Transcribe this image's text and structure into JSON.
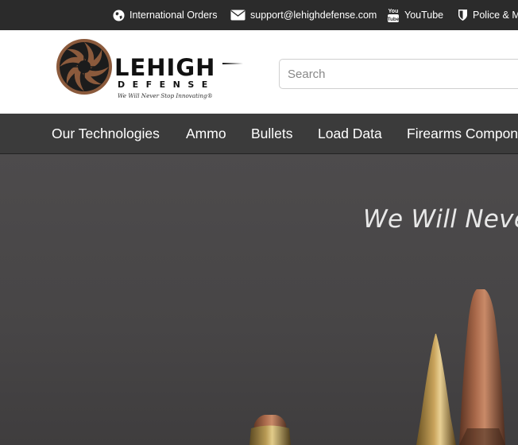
{
  "topbar": {
    "international_orders": "International Orders",
    "email": "support@lehighdefense.com",
    "youtube": "YouTube",
    "police_military": "Police & Mi"
  },
  "header": {
    "logo_wordmark": "LEHIGH",
    "logo_sub": "DEFENSE",
    "logo_tagline": "We Will Never Stop Innovating®",
    "search_placeholder": "Search"
  },
  "nav": {
    "items": [
      "Our Technologies",
      "Ammo",
      "Bullets",
      "Load Data",
      "Firearms Compon"
    ]
  },
  "hero": {
    "headline": "We Will Never"
  },
  "colors": {
    "topbar_bg": "#2b2b2b",
    "nav_bg": "#3b3b3b",
    "hero_bg": "#4a4849",
    "brand_copper": "#8b5a3c"
  },
  "icons": [
    "globe-icon",
    "envelope-icon",
    "youtube-icon",
    "shield-icon",
    "search-icon"
  ]
}
